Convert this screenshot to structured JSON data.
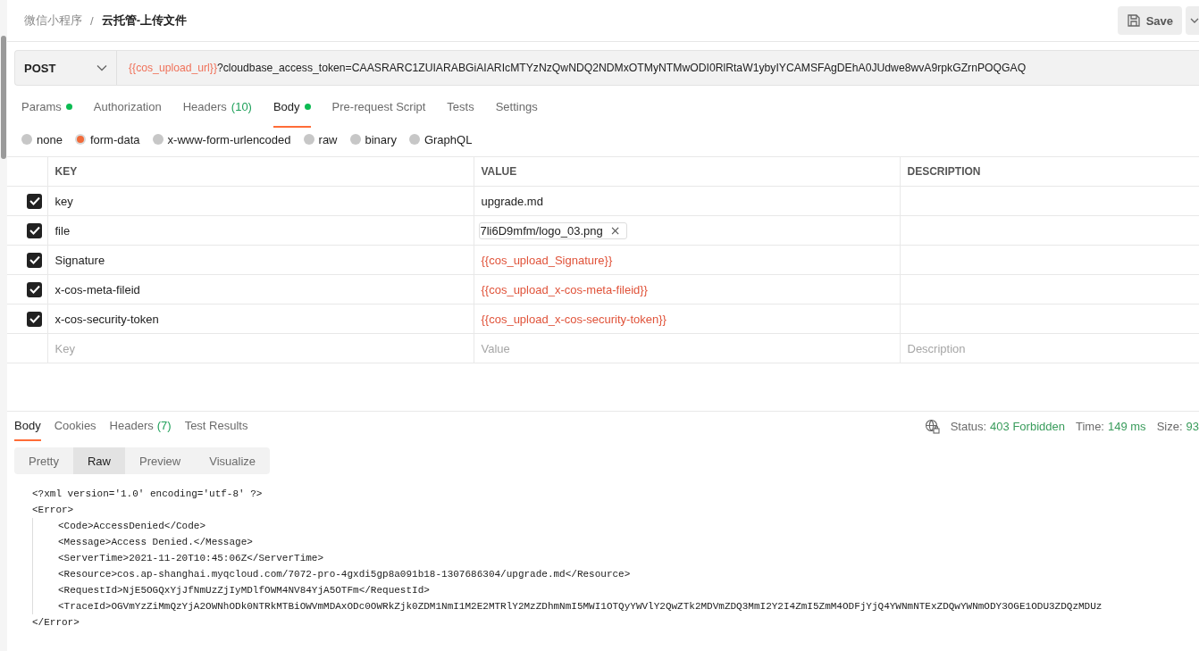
{
  "breadcrumb": {
    "parent": "微信小程序",
    "separator": "/",
    "current": "云托管-上传文件"
  },
  "save_button": {
    "label": "Save"
  },
  "request": {
    "method": "POST",
    "url_variable": "{{cos_upload_url}}",
    "url_rest": "?cloudbase_access_token=CAASRARC1ZUIARABGiAIARIcMTYzNzQwNDQ2NDMxOTMyNTMwODI0RlRtaW1ybyIYCAMSFAgDEhA0JUdwe8wvA9rpkGZrnPOQGAQ"
  },
  "request_tabs": [
    {
      "label": "Params",
      "dot": true,
      "selected": false
    },
    {
      "label": "Authorization",
      "dot": false,
      "selected": false
    },
    {
      "label": "Headers",
      "count": "(10)",
      "dot": false,
      "selected": false
    },
    {
      "label": "Body",
      "dot": true,
      "selected": true
    },
    {
      "label": "Pre-request Script",
      "dot": false,
      "selected": false
    },
    {
      "label": "Tests",
      "dot": false,
      "selected": false
    },
    {
      "label": "Settings",
      "dot": false,
      "selected": false
    }
  ],
  "body_types": [
    {
      "label": "none",
      "selected": false
    },
    {
      "label": "form-data",
      "selected": true
    },
    {
      "label": "x-www-form-urlencoded",
      "selected": false
    },
    {
      "label": "raw",
      "selected": false
    },
    {
      "label": "binary",
      "selected": false
    },
    {
      "label": "GraphQL",
      "selected": false
    }
  ],
  "params_table": {
    "columns": [
      "KEY",
      "VALUE",
      "DESCRIPTION"
    ],
    "rows": [
      {
        "checked": true,
        "key": "key",
        "kind": "text",
        "value": "upgrade.md"
      },
      {
        "checked": true,
        "key": "file",
        "kind": "file",
        "value": "7li6D9mfm/logo_03.png",
        "remove": "×"
      },
      {
        "checked": true,
        "key": "Signature",
        "kind": "variable",
        "value": "{{cos_upload_Signature}}"
      },
      {
        "checked": true,
        "key": "x-cos-meta-fileid",
        "kind": "variable",
        "value": "{{cos_upload_x-cos-meta-fileid}}"
      },
      {
        "checked": true,
        "key": "x-cos-security-token",
        "kind": "variable",
        "value": "{{cos_upload_x-cos-security-token}}"
      }
    ],
    "new_row": {
      "key_placeholder": "Key",
      "value_placeholder": "Value",
      "description_placeholder": "Description"
    }
  },
  "response_tabs": [
    {
      "label": "Body",
      "selected": true
    },
    {
      "label": "Cookies",
      "selected": false
    },
    {
      "label": "Headers",
      "count": "(7)",
      "selected": false
    },
    {
      "label": "Test Results",
      "selected": false
    }
  ],
  "response_status": [
    {
      "label": "Status:",
      "value": "403 Forbidden"
    },
    {
      "label": "Time:",
      "value": "149 ms"
    },
    {
      "label": "Size:",
      "value": "93"
    }
  ],
  "view_modes": [
    {
      "label": "Pretty",
      "selected": false
    },
    {
      "label": "Raw",
      "selected": true
    },
    {
      "label": "Preview",
      "selected": false
    },
    {
      "label": "Visualize",
      "selected": false
    }
  ],
  "response_body": [
    {
      "text": "<?xml version='1.0' encoding='utf-8' ?>"
    },
    {
      "text": "<Error>",
      "children": [
        {
          "text": "<Code>AccessDenied</Code>"
        },
        {
          "text": "<Message>Access Denied.</Message>"
        },
        {
          "text": "<ServerTime>2021-11-20T10:45:06Z</ServerTime>"
        },
        {
          "text": "<Resource>cos.ap-shanghai.myqcloud.com/7072-pro-4gxdi5gp8a091b18-1307686304/upgrade.md</Resource>"
        },
        {
          "text": "<RequestId>NjE5OGQxYjJfNmUzZjIyMDlfOWM4NV84YjA5OTFm</RequestId>"
        },
        {
          "text": "<TraceId>OGVmYzZiMmQzYjA2OWNhODk0NTRkMTBiOWVmMDAxODc0OWRkZjk0ZDM1NmI1M2E2MTRlY2MzZDhmNmI5MWI1OTQyYWVlY2QwZTk2MDVmZDQ3MmI2Y2I4ZmI5ZmM4ODFjYjQ4YWNmNTExZDQwYWNmODY3OGE1ODU3ZDQzMDUz"
        }
      ]
    },
    {
      "text": "</Error>"
    }
  ]
}
